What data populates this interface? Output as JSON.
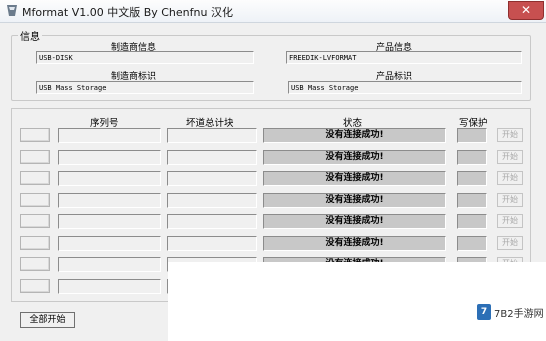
{
  "window": {
    "title": "Mformat V1.00 中文版 By Chenfnu 汉化",
    "close_glyph": "✕"
  },
  "info": {
    "legend": "信息",
    "manufacturer_info_label": "制造商信息",
    "manufacturer_info_value": "USB-DISK",
    "product_info_label": "产品信息",
    "product_info_value": "FREEDIK-LVFORMAT",
    "manufacturer_id_label": "制造商标识",
    "manufacturer_id_value": "USB Mass Storage",
    "product_id_label": "产品标识",
    "product_id_value": "USB Mass Storage"
  },
  "table": {
    "col_serial": "序列号",
    "col_badblocks": "坏道总计块",
    "col_status": "状态",
    "col_writeprotect": "写保护",
    "start_label": "开始",
    "rows": [
      {
        "status": "没有连接成功!"
      },
      {
        "status": "没有连接成功!"
      },
      {
        "status": "没有连接成功!"
      },
      {
        "status": "没有连接成功!"
      },
      {
        "status": "没有连接成功!"
      },
      {
        "status": "没有连接成功!"
      },
      {
        "status": "没有连接成功!"
      },
      {
        "status": ""
      }
    ]
  },
  "start_all_label": "全部开始",
  "watermark": {
    "badge": "7",
    "text": "7B2手游网"
  },
  "colors": {
    "close_red": "#c75050",
    "status_gray": "#c8c8c8",
    "watermark_blue": "#2c6fb6"
  },
  "icons": {
    "app": "app-logo-icon",
    "close": "close-icon"
  }
}
